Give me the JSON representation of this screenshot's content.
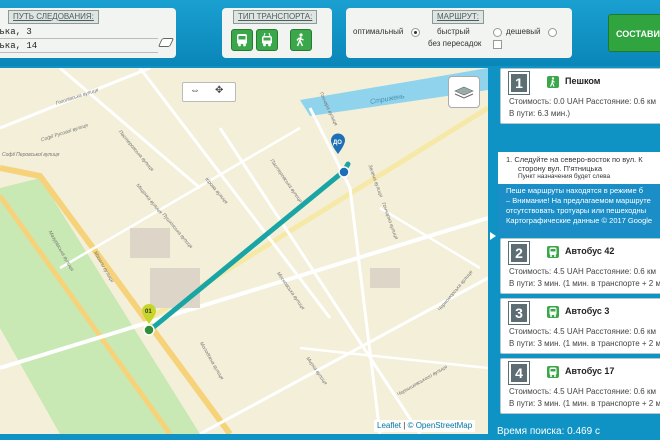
{
  "header": {
    "route_legend": "ПУТЬ СЛЕДОВАНИЯ:",
    "from_value": "ська, 3",
    "to_value": "ська, 14",
    "transport_legend": "ТИП ТРАНСПОРТА:",
    "transport_buttons": [
      "bus-icon",
      "trolleybus-icon",
      "pedestrian-icon"
    ],
    "routes_legend": "МАРШРУТ:",
    "options": {
      "optimal": "оптимальный",
      "fast": "быстрый",
      "cheap": "дешевый",
      "no_transfer": "без пересадок"
    },
    "build_button": "СОСТАВИТ"
  },
  "map": {
    "streets": [
      "Гоголівська вулиця",
      "Софії Русової вулиця",
      "Пастеровська вулиця",
      "Софії Перовської вулиця",
      "Гончара вулиця",
      "Стрижень",
      "Міщенка вулиця",
      "Пушкінська вулиця",
      "Мазурівська вулиця",
      "Мазепи вулиця",
      "Московська вулиця",
      "Зелена вулиця",
      "Чорноморська вулиця",
      "Чернишевського вулиця",
      "Гончарна вулиця",
      "Пастеровська вулиця",
      "Мирна вулиця",
      "Молодіжна вулиця",
      "Кірова вулиця"
    ],
    "marker_from": "01",
    "marker_to": "ДО",
    "attribution_leaflet": "Leaflet",
    "attribution_sep": "|",
    "attribution_copy": "© OpenStreetMap",
    "colors": {
      "route": "#1aa5a5",
      "water": "#8fd3ec",
      "park": "#c8e8b4"
    }
  },
  "routes": [
    {
      "num": "1",
      "icon": "pedestrian-icon",
      "title": "Пешком",
      "line1": "Стоимость: 0.0 UAH Расстояние: 0.6 км",
      "line2": "В пути: 6.3 мин.)"
    },
    {
      "num": "2",
      "icon": "bus-icon",
      "title": "Автобус 42",
      "line1": "Стоимость: 4.5 UAH Расстояние: 0.6 км",
      "line2": "В пути: 3 мин. (1 мин. в транспорте + 2 м"
    },
    {
      "num": "3",
      "icon": "bus-icon",
      "title": "Автобус 3",
      "line1": "Стоимость: 4.5 UAH Расстояние: 0.6 км",
      "line2": "В пути: 3 мин. (1 мин. в транспорте + 2 м"
    },
    {
      "num": "4",
      "icon": "bus-icon",
      "title": "Автобус 17",
      "line1": "Стоимость: 4.5 UAH Расстояние: 0.6 км",
      "line2": "В пути: 3 мин. (1 мин. в транспорте + 2 м"
    }
  ],
  "instructions": {
    "step1": "1.  Следуйте на северо-восток по вул. К",
    "step1b": "сторону вул. П'ятницька",
    "step1c": "Пункт назначения будет слева",
    "note1": "Пеше маршруты находятся в режиме б",
    "note2": "– Внимание! На предлагаемом маршруте",
    "note3": "отсутствовать тротуары или пешеходны",
    "note4": "Картографические данные © 2017 Google"
  },
  "search_time": "Время поиска: 0.469 с"
}
